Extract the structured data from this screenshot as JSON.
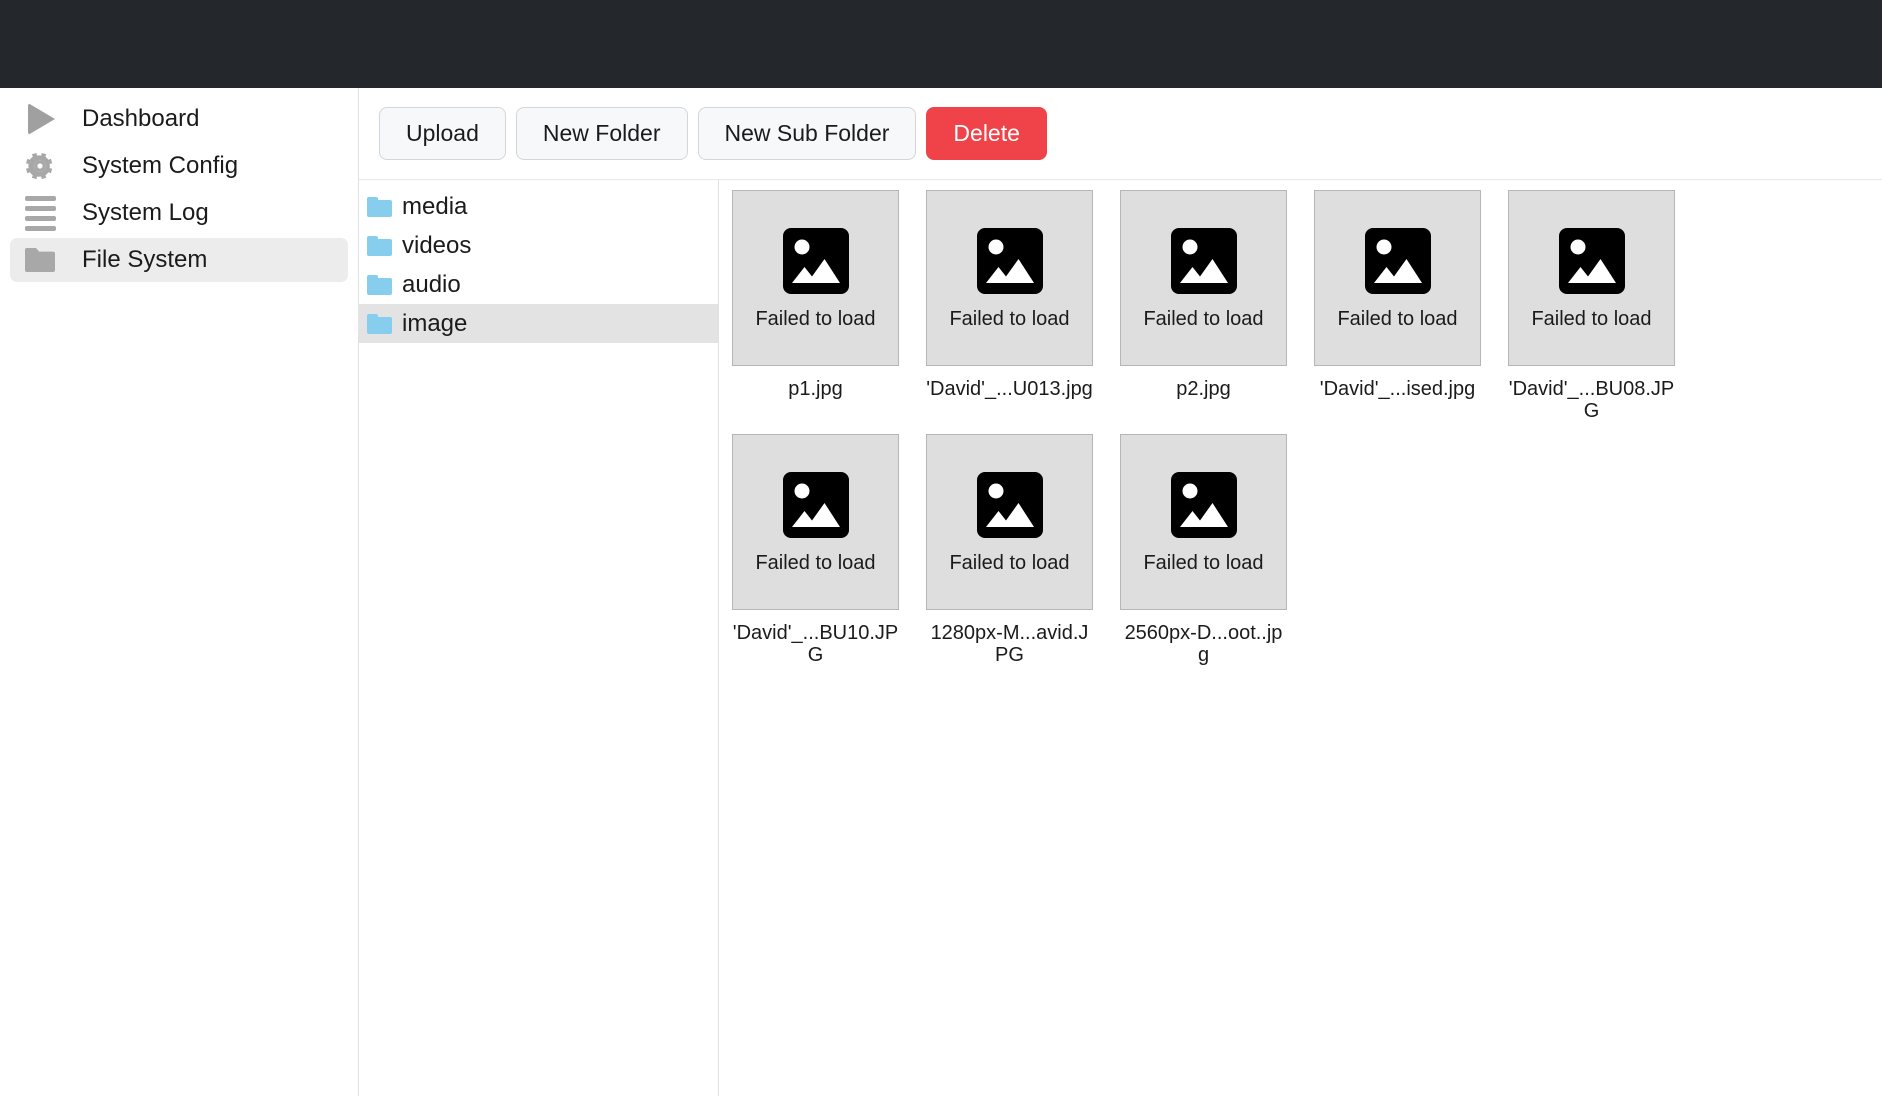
{
  "topbar": {
    "title": ""
  },
  "sidebar": {
    "items": [
      {
        "label": "Dashboard",
        "icon": "play-icon",
        "active": false
      },
      {
        "label": "System Config",
        "icon": "gear-icon",
        "active": false
      },
      {
        "label": "System Log",
        "icon": "list-lines-icon",
        "active": false
      },
      {
        "label": "File System",
        "icon": "folder-icon",
        "active": true
      }
    ]
  },
  "toolbar": {
    "buttons": [
      {
        "label": "Upload",
        "style": "default"
      },
      {
        "label": "New Folder",
        "style": "default"
      },
      {
        "label": "New Sub Folder",
        "style": "default"
      },
      {
        "label": "Delete",
        "style": "danger"
      }
    ],
    "danger_color": "#ef4349"
  },
  "tree": {
    "items": [
      {
        "label": "media",
        "active": false
      },
      {
        "label": "videos",
        "active": false
      },
      {
        "label": "audio",
        "active": false
      },
      {
        "label": "image",
        "active": true
      }
    ],
    "folder_color": "#86cdee",
    "selected_bg": "#e3e3e3"
  },
  "files": {
    "failed_text": "Failed to load",
    "items": [
      {
        "name": "p1.jpg",
        "status": "Failed to load"
      },
      {
        "name": "'David'_...U013.jpg",
        "status": "Failed to load"
      },
      {
        "name": "p2.jpg",
        "status": "Failed to load"
      },
      {
        "name": "'David'_...ised.jpg",
        "status": "Failed to load"
      },
      {
        "name": "'David'_...BU08.JPG",
        "status": "Failed to load"
      },
      {
        "name": "'David'_...BU10.JPG",
        "status": "Failed to load"
      },
      {
        "name": "1280px-M...avid.JPG",
        "status": "Failed to load"
      },
      {
        "name": "2560px-D...oot..jpg",
        "status": "Failed to load"
      }
    ]
  }
}
